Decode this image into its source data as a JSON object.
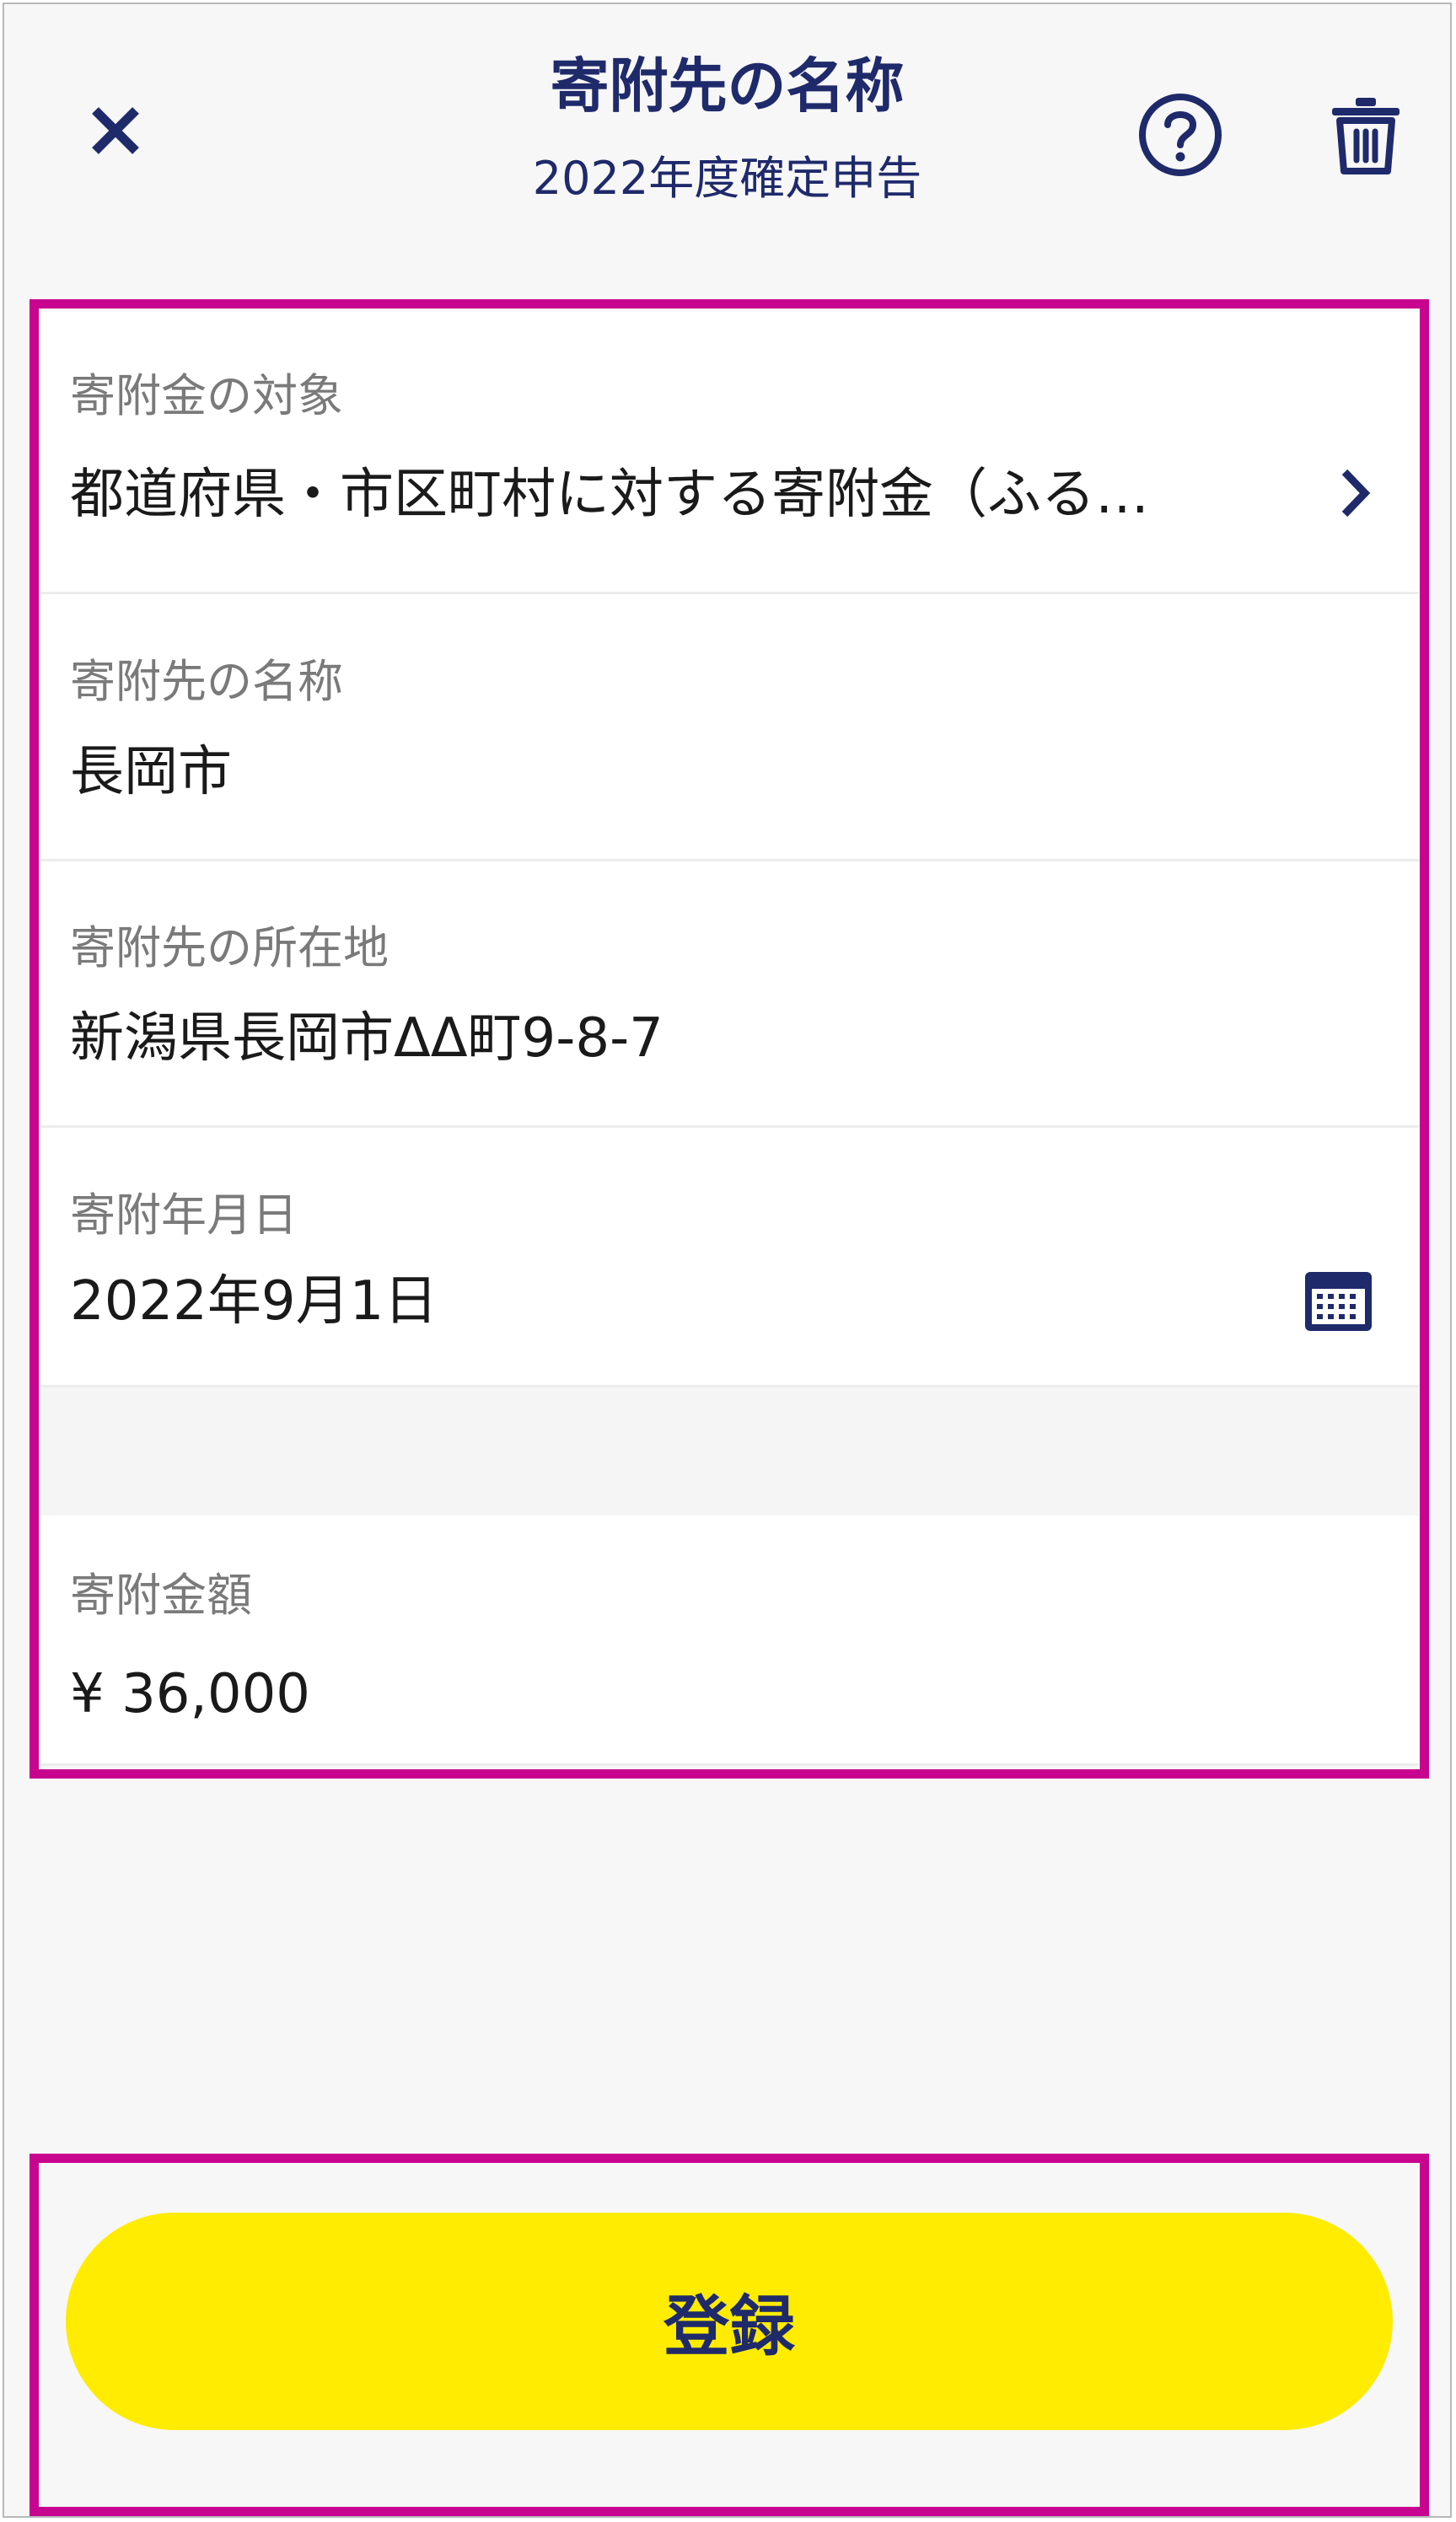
{
  "header": {
    "title": "寄附先の名称",
    "subtitle": "2022年度確定申告"
  },
  "fields": [
    {
      "label": "寄附金の対象",
      "value": "都道府県・市区町村に対する寄附金（ふる…"
    },
    {
      "label": "寄附先の名称",
      "value": "長岡市"
    },
    {
      "label": "寄附先の所在地",
      "value": "新潟県長岡市ΔΔ町9-8-7"
    },
    {
      "label": "寄附年月日",
      "value": "2022年9月1日"
    },
    {
      "label": "寄附金額",
      "value": "¥ 36,000"
    }
  ],
  "actions": {
    "register_label": "登録"
  },
  "colors": {
    "accent_navy": "#1f2a6b",
    "button_yellow": "#ffec00",
    "highlight_magenta": "#c8058f"
  },
  "icons": {
    "close": "close-icon",
    "help": "help-circle-icon",
    "trash": "trash-icon",
    "chevron": "chevron-right-icon",
    "calendar": "calendar-icon"
  }
}
